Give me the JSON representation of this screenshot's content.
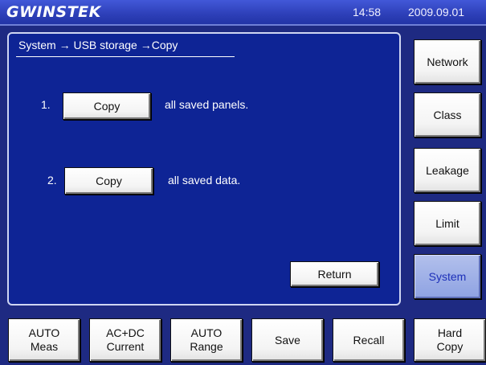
{
  "header": {
    "brand": "GWINSTEK",
    "time": "14:58",
    "date": "2009.09.01"
  },
  "main": {
    "breadcrumb": "System → USB storage →Copy",
    "items": [
      {
        "number": "1.",
        "button_label": "Copy",
        "description": "all saved panels."
      },
      {
        "number": "2.",
        "button_label": "Copy",
        "description": "all saved data."
      }
    ],
    "return_label": "Return"
  },
  "sidebar": {
    "items": [
      {
        "label": "Network",
        "active": false
      },
      {
        "label": "Class",
        "active": false
      },
      {
        "label": "Leakage",
        "active": false
      },
      {
        "label": "Limit",
        "active": false
      },
      {
        "label": "System",
        "active": true
      }
    ]
  },
  "bottom": {
    "buttons": [
      {
        "label": "AUTO\nMeas"
      },
      {
        "label": "AC+DC\nCurrent"
      },
      {
        "label": "AUTO\nRange"
      },
      {
        "label": "Save"
      },
      {
        "label": "Recall"
      },
      {
        "label": "Hard\nCopy"
      }
    ]
  },
  "colors": {
    "background": "#1e2a82",
    "panel": "#0e2495",
    "header": "#2d3fb8",
    "active_button": "#8ea2e2"
  }
}
